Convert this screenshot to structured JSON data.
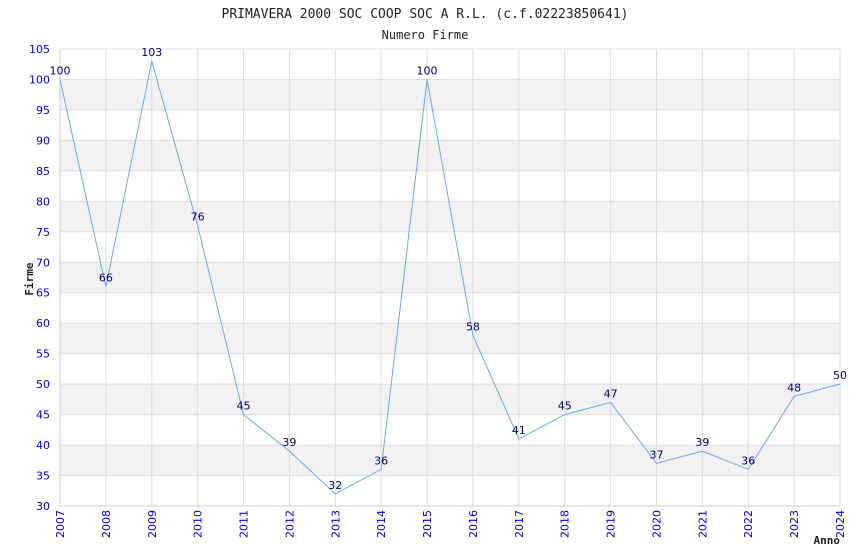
{
  "chart_data": {
    "type": "line",
    "title": "PRIMAVERA 2000 SOC COOP SOC A R.L. (c.f.02223850641)",
    "subtitle": "Numero Firme",
    "xlabel": "Anno",
    "ylabel": "Firme",
    "ylim": [
      30,
      105
    ],
    "y_step": 5,
    "grid": true,
    "x": [
      "2007",
      "2008",
      "2009",
      "2010",
      "2011",
      "2012",
      "2013",
      "2014",
      "2015",
      "2016",
      "2017",
      "2018",
      "2019",
      "2020",
      "2021",
      "2022",
      "2023",
      "2024"
    ],
    "series": [
      {
        "values": [
          100,
          66,
          103,
          76,
          45,
          39,
          32,
          36,
          100,
          58,
          41,
          45,
          47,
          37,
          39,
          36,
          48,
          50
        ]
      }
    ],
    "colors": {
      "line": "#6aaaf0",
      "band": "#f2f2f2",
      "grid": "#dddddd",
      "tick_text": "#0000cc",
      "data_label": "#000066"
    }
  }
}
